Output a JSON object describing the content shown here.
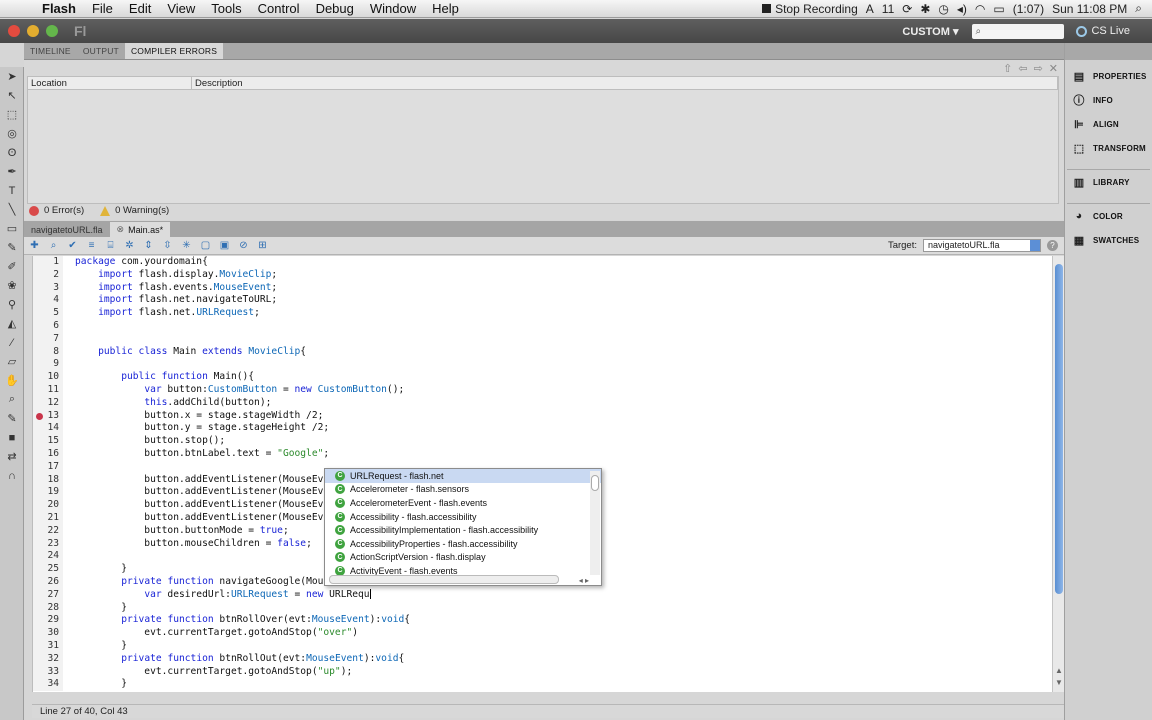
{
  "menubar": {
    "app": "Flash",
    "items": [
      "File",
      "Edit",
      "View",
      "Tools",
      "Control",
      "Debug",
      "Window",
      "Help"
    ],
    "stop_recording": "Stop Recording",
    "adobe_count": "11",
    "battery": "(1:07)",
    "clock": "Sun 11:08 PM"
  },
  "appbar": {
    "logo": "Fl",
    "workspace": "CUSTOM ▾",
    "search_placeholder": "",
    "cs_live": "CS Live"
  },
  "panel_tabs": [
    "TIMELINE",
    "OUTPUT",
    "COMPILER ERRORS"
  ],
  "compiler_errors": {
    "col_location": "Location",
    "col_description": "Description",
    "errors": "0 Error(s)",
    "warnings": "0 Warning(s)"
  },
  "doc_tabs": [
    "navigatetoURL.fla",
    "Main.as*"
  ],
  "editor_toolbar": {
    "target_label": "Target:",
    "target_value": "navigatetoURL.fla"
  },
  "code_lines": [
    {
      "n": "1",
      "t": "package com.yourdomain{"
    },
    {
      "n": "2",
      "t": "    import flash.display.MovieClip;"
    },
    {
      "n": "3",
      "t": "    import flash.events.MouseEvent;"
    },
    {
      "n": "4",
      "t": "    import flash.net.navigateToURL;"
    },
    {
      "n": "5",
      "t": "    import flash.net.URLRequest;"
    },
    {
      "n": "6",
      "t": ""
    },
    {
      "n": "7",
      "t": ""
    },
    {
      "n": "8",
      "t": "    public class Main extends MovieClip{"
    },
    {
      "n": "9",
      "t": ""
    },
    {
      "n": "10",
      "t": "        public function Main(){"
    },
    {
      "n": "11",
      "t": "            var button:CustomButton = new CustomButton();"
    },
    {
      "n": "12",
      "t": "            this.addChild(button);"
    },
    {
      "n": "13",
      "t": "            button.x = stage.stageWidth /2;"
    },
    {
      "n": "14",
      "t": "            button.y = stage.stageHeight /2;"
    },
    {
      "n": "15",
      "t": "            button.stop();"
    },
    {
      "n": "16",
      "t": "            button.btnLabel.text = \"Google\";"
    },
    {
      "n": "17",
      "t": ""
    },
    {
      "n": "18",
      "t": "            button.addEventListener(MouseEve"
    },
    {
      "n": "19",
      "t": "            button.addEventListener(MouseEve"
    },
    {
      "n": "20",
      "t": "            button.addEventListener(MouseEve"
    },
    {
      "n": "21",
      "t": "            button.addEventListener(MouseEve"
    },
    {
      "n": "22",
      "t": "            button.buttonMode = true;"
    },
    {
      "n": "23",
      "t": "            button.mouseChildren = false;"
    },
    {
      "n": "24",
      "t": ""
    },
    {
      "n": "25",
      "t": "        }"
    },
    {
      "n": "26",
      "t": "        private function navigateGoogle(Mous"
    },
    {
      "n": "27",
      "t": "            var desiredUrl:URLRequest = new URLRequ"
    },
    {
      "n": "28",
      "t": "        }"
    },
    {
      "n": "29",
      "t": "        private function btnRollOver(evt:MouseEvent):void{"
    },
    {
      "n": "30",
      "t": "            evt.currentTarget.gotoAndStop(\"over\")"
    },
    {
      "n": "31",
      "t": "        }"
    },
    {
      "n": "32",
      "t": "        private function btnRollOut(evt:MouseEvent):void{"
    },
    {
      "n": "33",
      "t": "            evt.currentTarget.gotoAndStop(\"up\");"
    },
    {
      "n": "34",
      "t": "        }"
    }
  ],
  "breakpoint_line": "13",
  "code_hints": [
    "URLRequest - flash.net",
    "Accelerometer - flash.sensors",
    "AccelerometerEvent - flash.events",
    "Accessibility - flash.accessibility",
    "AccessibilityImplementation - flash.accessibility",
    "AccessibilityProperties - flash.accessibility",
    "ActionScriptVersion - flash.display",
    "ActivityEvent - flash.events"
  ],
  "status": "Line 27 of 40, Col 43",
  "right_dock": {
    "group1": [
      "PROPERTIES",
      "INFO",
      "ALIGN",
      "TRANSFORM"
    ],
    "group2": [
      "LIBRARY"
    ],
    "group3": [
      "COLOR",
      "SWATCHES"
    ]
  }
}
